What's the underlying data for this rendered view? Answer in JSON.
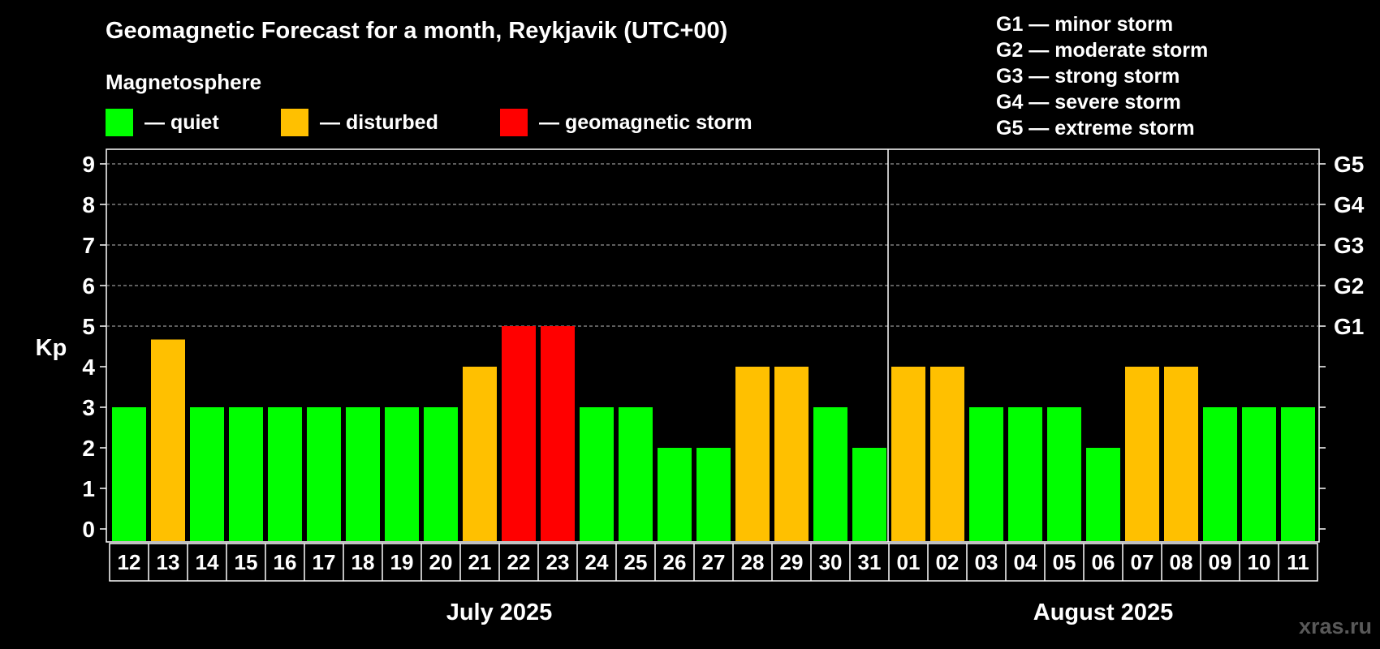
{
  "header": {
    "title": "Geomagnetic Forecast for a month, Reykjavik (UTC+00)",
    "magnetosphere_label": "Magnetosphere"
  },
  "legend": [
    {
      "label": "— quiet",
      "color": "#00ff00"
    },
    {
      "label": "— disturbed",
      "color": "#ffc000"
    },
    {
      "label": "— geomagnetic storm",
      "color": "#ff0000"
    }
  ],
  "storm_scale": [
    "G1 — minor storm",
    "G2 — moderate storm",
    "G3 — strong storm",
    "G4 — severe storm",
    "G5 — extreme storm"
  ],
  "watermark": "xras.ru",
  "chart_data": {
    "type": "bar",
    "ylabel": "Kp",
    "ylim": [
      0,
      9
    ],
    "yticks": [
      0,
      1,
      2,
      3,
      4,
      5,
      6,
      7,
      8,
      9
    ],
    "right_axis_labels": [
      {
        "kp": 5,
        "label": "G1"
      },
      {
        "kp": 6,
        "label": "G2"
      },
      {
        "kp": 7,
        "label": "G3"
      },
      {
        "kp": 8,
        "label": "G4"
      },
      {
        "kp": 9,
        "label": "G5"
      }
    ],
    "grid": "dashed horizontal",
    "categories": [
      "12",
      "13",
      "14",
      "15",
      "16",
      "17",
      "18",
      "19",
      "20",
      "21",
      "22",
      "23",
      "24",
      "25",
      "26",
      "27",
      "28",
      "29",
      "30",
      "31",
      "01",
      "02",
      "03",
      "04",
      "05",
      "06",
      "07",
      "08",
      "09",
      "10",
      "11"
    ],
    "values": [
      3,
      4.67,
      3,
      3,
      3,
      3,
      3,
      3,
      3,
      4,
      5,
      5,
      3,
      3,
      2,
      2,
      4,
      4,
      3,
      2,
      4,
      4,
      3,
      3,
      3,
      2,
      4,
      4,
      3,
      3,
      3
    ],
    "status": [
      "quiet",
      "disturbed",
      "quiet",
      "quiet",
      "quiet",
      "quiet",
      "quiet",
      "quiet",
      "quiet",
      "disturbed",
      "storm",
      "storm",
      "quiet",
      "quiet",
      "quiet",
      "quiet",
      "disturbed",
      "disturbed",
      "quiet",
      "quiet",
      "disturbed",
      "disturbed",
      "quiet",
      "quiet",
      "quiet",
      "quiet",
      "disturbed",
      "disturbed",
      "quiet",
      "quiet",
      "quiet"
    ],
    "months": [
      {
        "label": "July 2025",
        "first_index": 0,
        "last_index": 19
      },
      {
        "label": "August 2025",
        "first_index": 20,
        "last_index": 30
      }
    ]
  }
}
